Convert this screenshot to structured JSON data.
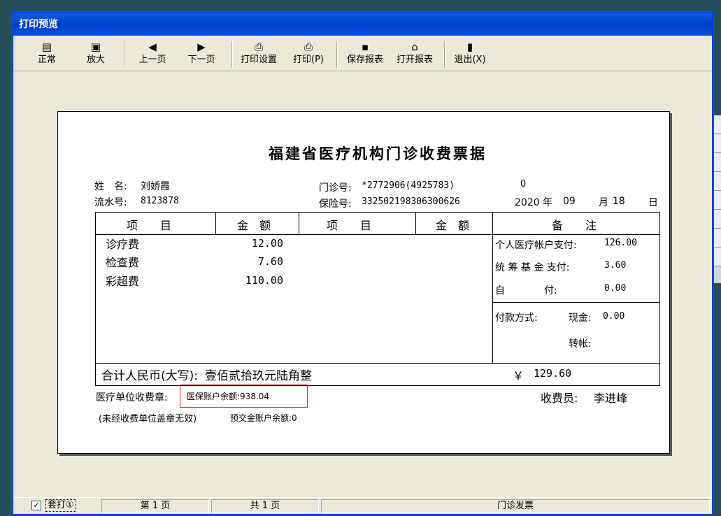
{
  "window": {
    "title": "打印预览"
  },
  "toolbar": {
    "normal": {
      "label": "正常",
      "icon": "page-icon"
    },
    "zoom": {
      "label": "放大",
      "icon": "zoom-icon"
    },
    "prev": {
      "label": "上一页",
      "icon": "arrow-left-icon"
    },
    "next": {
      "label": "下一页",
      "icon": "arrow-right-icon"
    },
    "print_setup": {
      "label": "打印设置",
      "icon": "printer-setup-icon"
    },
    "print": {
      "label": "打印(P)",
      "icon": "printer-icon"
    },
    "save": {
      "label": "保存报表",
      "icon": "floppy-icon"
    },
    "open": {
      "label": "打开报表",
      "icon": "folder-open-icon"
    },
    "exit": {
      "label": "退出(X)",
      "icon": "exit-door-icon"
    }
  },
  "receipt": {
    "title": "福建省医疗机构门诊收费票据",
    "name_label": "姓　名:",
    "name": "刘娇霞",
    "clinic_no_label": "门诊号:",
    "clinic_no": "*2772906(4925783)",
    "zero_mark": "0",
    "serial_label": "流水号:",
    "serial": "8123878",
    "insurance_label": "保险号:",
    "insurance": "332502198306300626",
    "date_year": "2020 年",
    "date_month": "09",
    "date_month_unit": "月",
    "date_day": "18",
    "date_day_unit": "日",
    "headers": {
      "item1": "项　　目",
      "amount1": "金　额",
      "item2": "项　　目",
      "amount2": "金　额",
      "remark": "备　　注"
    },
    "items": [
      {
        "name": "诊疗费",
        "amount": "12.00"
      },
      {
        "name": "检查费",
        "amount": "7.60"
      },
      {
        "name": "彩超费",
        "amount": "110.00"
      }
    ],
    "remarks": {
      "personal_account_label": "个人医疗帐户支付:",
      "personal_account": "126.00",
      "pooled_fund_label": "统 筹 基 金 支付:",
      "pooled_fund": "3.60",
      "self_pay_label": "自　　　　付:",
      "self_pay": "0.00",
      "payment_method_label": "付款方式:",
      "cash_label": "现金:",
      "cash": "0.00",
      "transfer_label": "转帐:"
    },
    "total_label": "合计人民币(大写):",
    "total_words": "壹佰贰拾玖元陆角整",
    "total_symbol": "￥",
    "total_amount": "129.60",
    "stamp_label": "医疗单位收费章:",
    "insurance_balance": "医保账户余额:938.04",
    "cashier_label": "收费员:",
    "cashier": "李进峰",
    "note": "(未经收费单位盖章无效)",
    "prepay_balance": "预交金账户余额:0"
  },
  "statusbar": {
    "checkbox_mark": "✓",
    "overprint_label": "套打①",
    "page_current": "第 1 页",
    "page_total": "共 1 页",
    "doc_name": "门诊发票"
  }
}
